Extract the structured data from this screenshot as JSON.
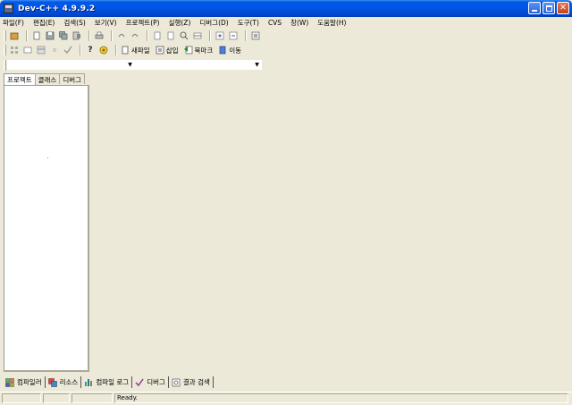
{
  "window": {
    "title": "Dev-C++ 4.9.9.2",
    "controls": [
      "minimize",
      "maximize",
      "close"
    ]
  },
  "menubar": {
    "items": [
      "파일(F)",
      "편집(E)",
      "검색(S)",
      "보기(V)",
      "프로젝트(P)",
      "실행(Z)",
      "디버그(D)",
      "도구(T)",
      "CVS",
      "창(W)",
      "도움말(H)"
    ]
  },
  "toolbar": {
    "new_file_label": "새파일",
    "insert_label": "삽입",
    "bookmark_label": "북마크",
    "goto_label": "이동"
  },
  "combos": {
    "class_combo_value": "",
    "member_combo_value": ""
  },
  "left_tabs": [
    "프로젝트",
    "클래스",
    "디버그"
  ],
  "bottom_tabs": [
    "컴파일러",
    "리소스",
    "컴파일 로그",
    "디버그",
    "결과 검색"
  ],
  "status": {
    "cell1": "",
    "cell2": "",
    "cell3": "",
    "message": "Ready."
  },
  "colors": {
    "title_bar": "#0055e5",
    "face": "#ece9d8",
    "panel": "#ffffff"
  }
}
